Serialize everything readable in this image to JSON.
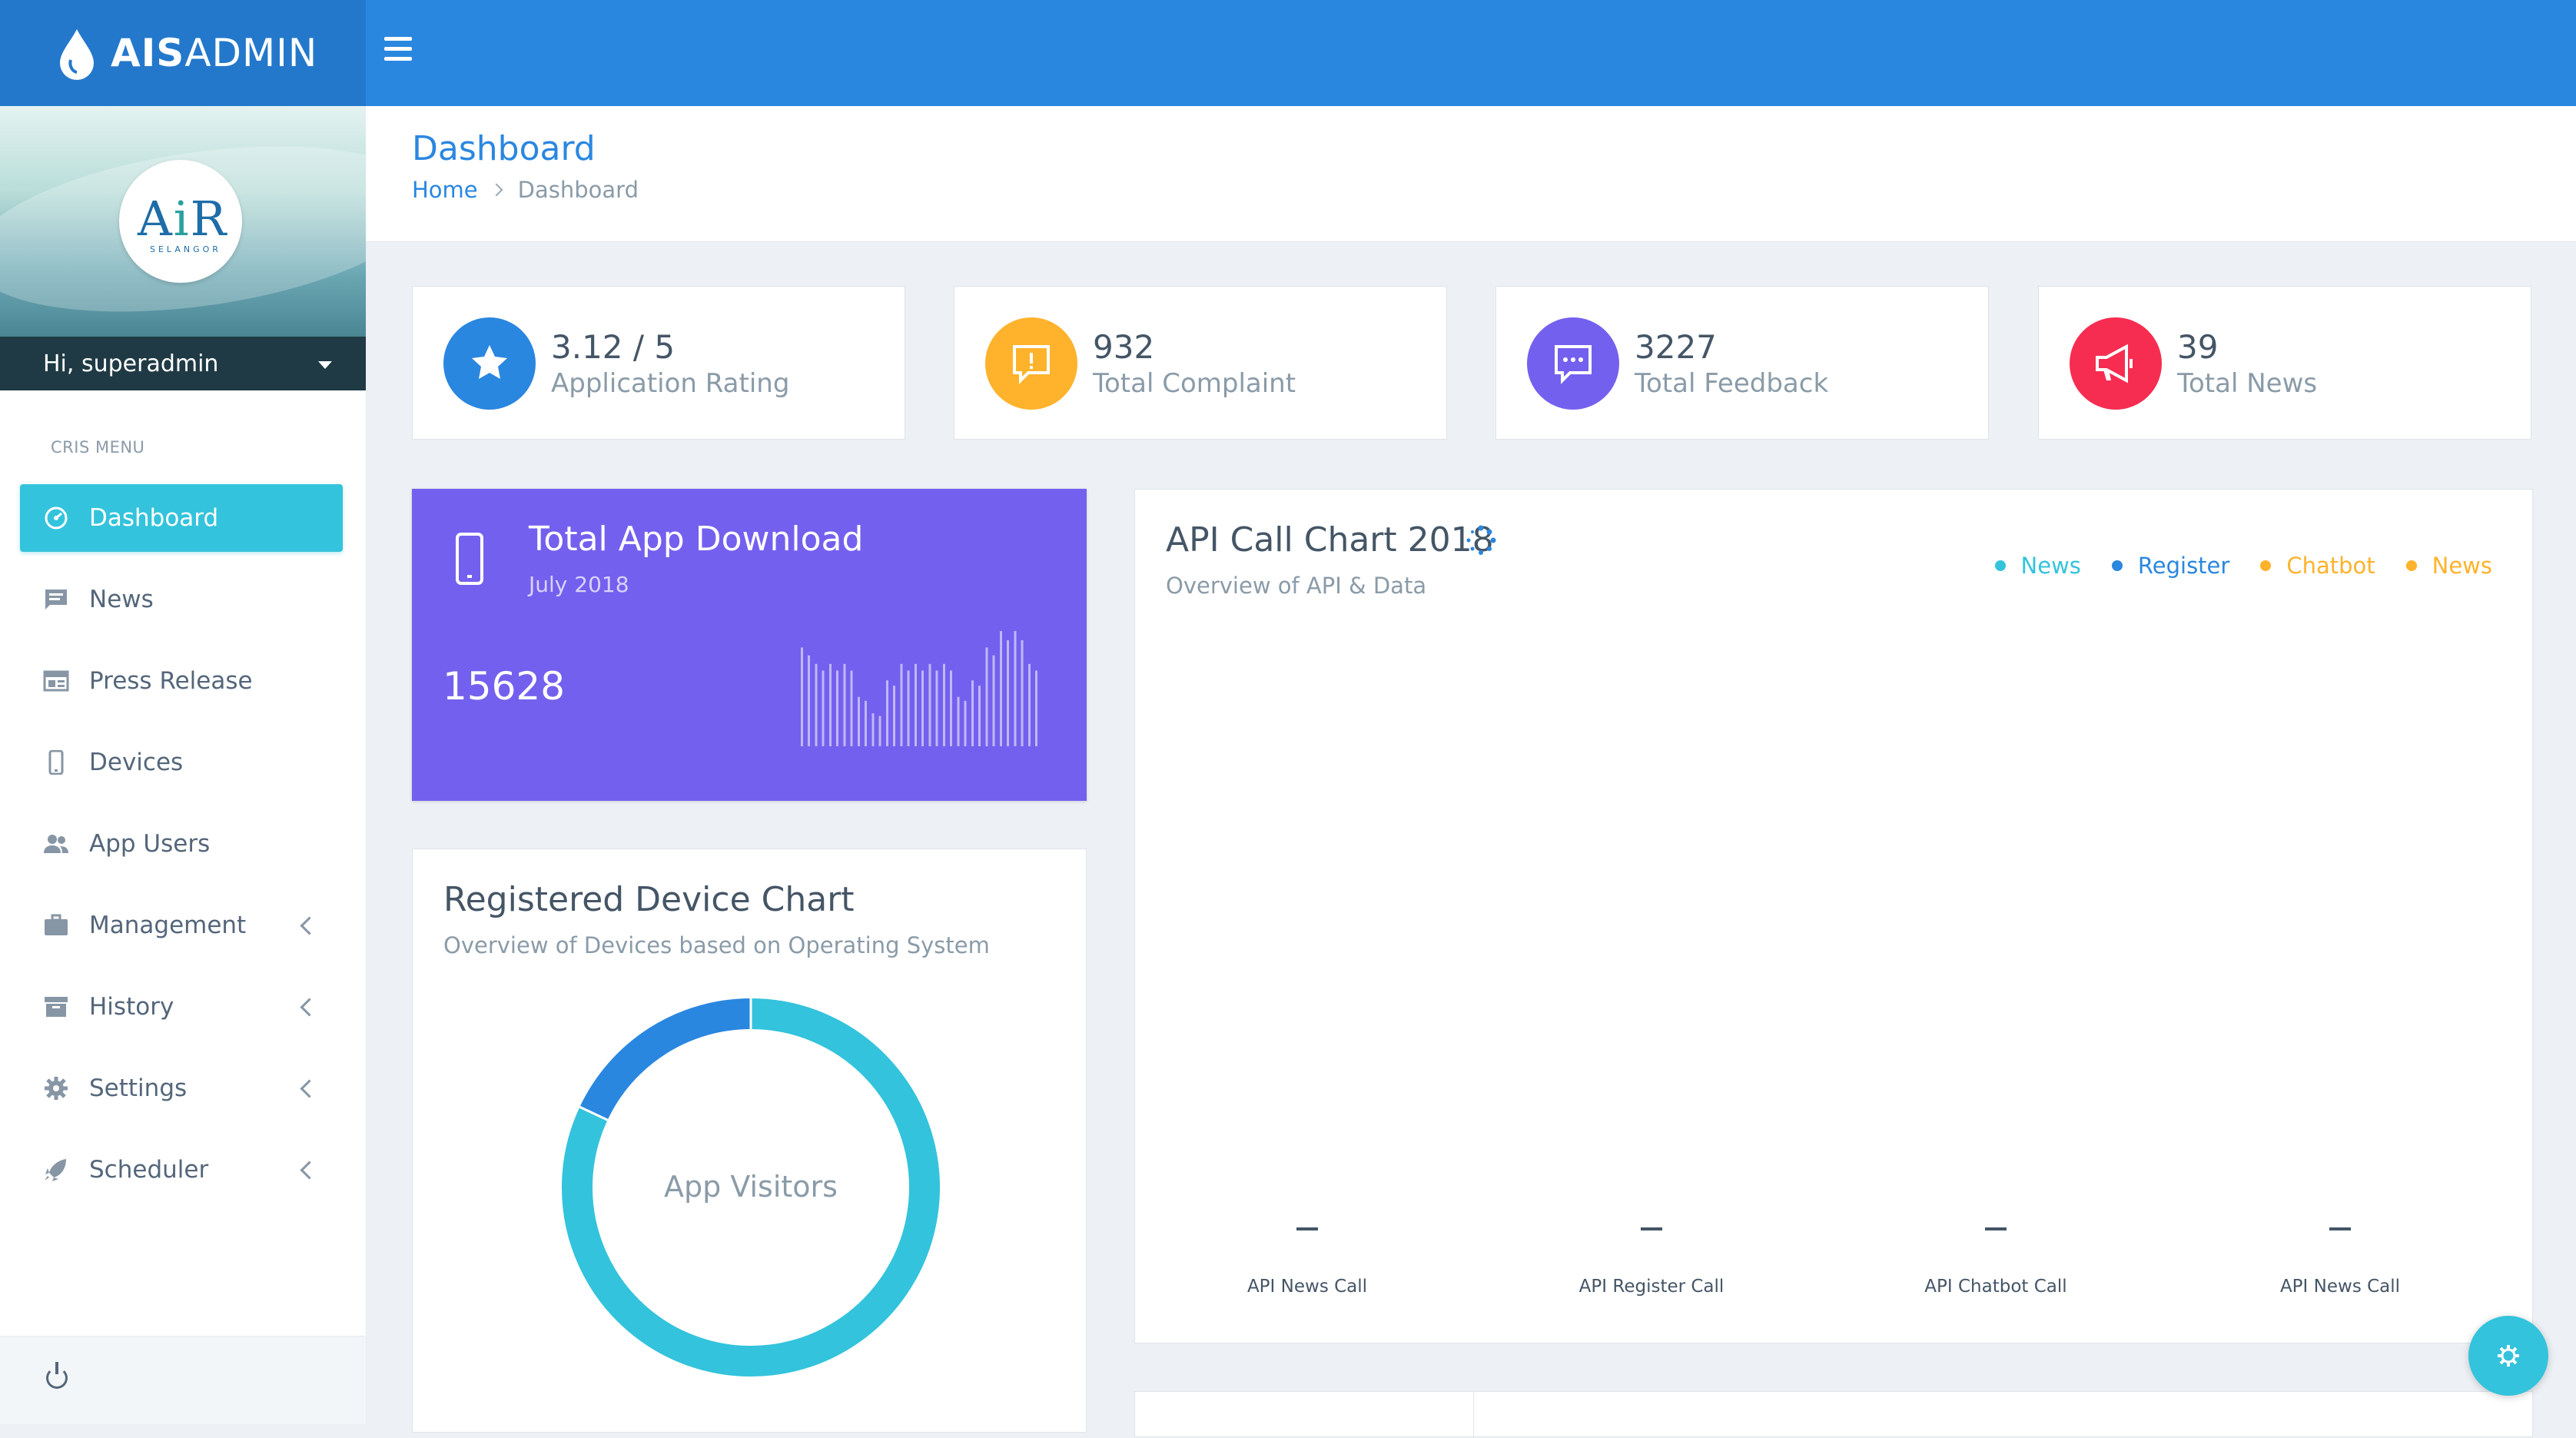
{
  "brand": {
    "bold": "AIS",
    "light": "ADMIN"
  },
  "profile": {
    "logo_main_left": "A",
    "logo_mid": "i",
    "logo_main_right": "R",
    "logo_sub": "SELANGOR",
    "greeting": "Hi, superadmin"
  },
  "sidebar": {
    "caption": "CRIS MENU",
    "items": [
      {
        "label": "Dashboard",
        "icon": "dashboard-icon",
        "active": true,
        "has_submenu": false
      },
      {
        "label": "News",
        "icon": "news-icon",
        "active": false,
        "has_submenu": false
      },
      {
        "label": "Press Release",
        "icon": "press-release-icon",
        "active": false,
        "has_submenu": false
      },
      {
        "label": "Devices",
        "icon": "mobile-device-icon",
        "active": false,
        "has_submenu": false
      },
      {
        "label": "App Users",
        "icon": "users-icon",
        "active": false,
        "has_submenu": false
      },
      {
        "label": "Management",
        "icon": "briefcase-icon",
        "active": false,
        "has_submenu": true
      },
      {
        "label": "History",
        "icon": "archive-icon",
        "active": false,
        "has_submenu": true
      },
      {
        "label": "Settings",
        "icon": "gear-icon",
        "active": false,
        "has_submenu": true
      },
      {
        "label": "Scheduler",
        "icon": "rocket-icon",
        "active": false,
        "has_submenu": true
      }
    ]
  },
  "page": {
    "title": "Dashboard",
    "breadcrumb": {
      "home": "Home",
      "current": "Dashboard"
    }
  },
  "stats": [
    {
      "value": "3.12 / 5",
      "caption": "Application Rating",
      "icon": "star-icon",
      "color": "#2a87e0"
    },
    {
      "value": "932",
      "caption": "Total Complaint",
      "icon": "complaint-icon",
      "color": "#ffb22b"
    },
    {
      "value": "3227",
      "caption": "Total Feedback",
      "icon": "feedback-icon",
      "color": "#7460ee"
    },
    {
      "value": "39",
      "caption": "Total News",
      "icon": "megaphone-icon",
      "color": "#f62d51"
    }
  ],
  "download": {
    "title": "Total App Download",
    "period": "July 2018",
    "total": "15628",
    "color": "#7460ee"
  },
  "device_chart": {
    "title": "Registered Device Chart",
    "subtitle": "Overview of Devices based on Operating System",
    "center_label": "App Visitors"
  },
  "api_chart": {
    "title": "API Call Chart 2018",
    "subtitle": "Overview of API & Data",
    "legend": [
      {
        "label": "News",
        "color": "#33c3dc"
      },
      {
        "label": "Register",
        "color": "#2a87e0"
      },
      {
        "label": "Chatbot",
        "color": "#ffb22b"
      },
      {
        "label": "News",
        "color": "#ffb22b"
      }
    ],
    "categories": [
      {
        "label": "API News Call",
        "value": "–"
      },
      {
        "label": "API Register Call",
        "value": "–"
      },
      {
        "label": "API Chatbot Call",
        "value": "–"
      },
      {
        "label": "API News Call",
        "value": "–"
      }
    ]
  },
  "chart_data": [
    {
      "type": "bar",
      "title": "",
      "values": [
        6,
        5,
        5,
        5,
        3,
        2,
        4,
        5,
        5,
        5,
        5,
        3,
        4,
        6,
        7,
        7,
        5
      ],
      "color": "#ffffff"
    },
    {
      "type": "pie",
      "title": "Registered Device Chart",
      "center_label": "App Visitors",
      "slices": [
        {
          "share": 0.82,
          "color": "#33c3dc"
        },
        {
          "share": 0.18,
          "color": "#2a87e0"
        }
      ]
    }
  ]
}
